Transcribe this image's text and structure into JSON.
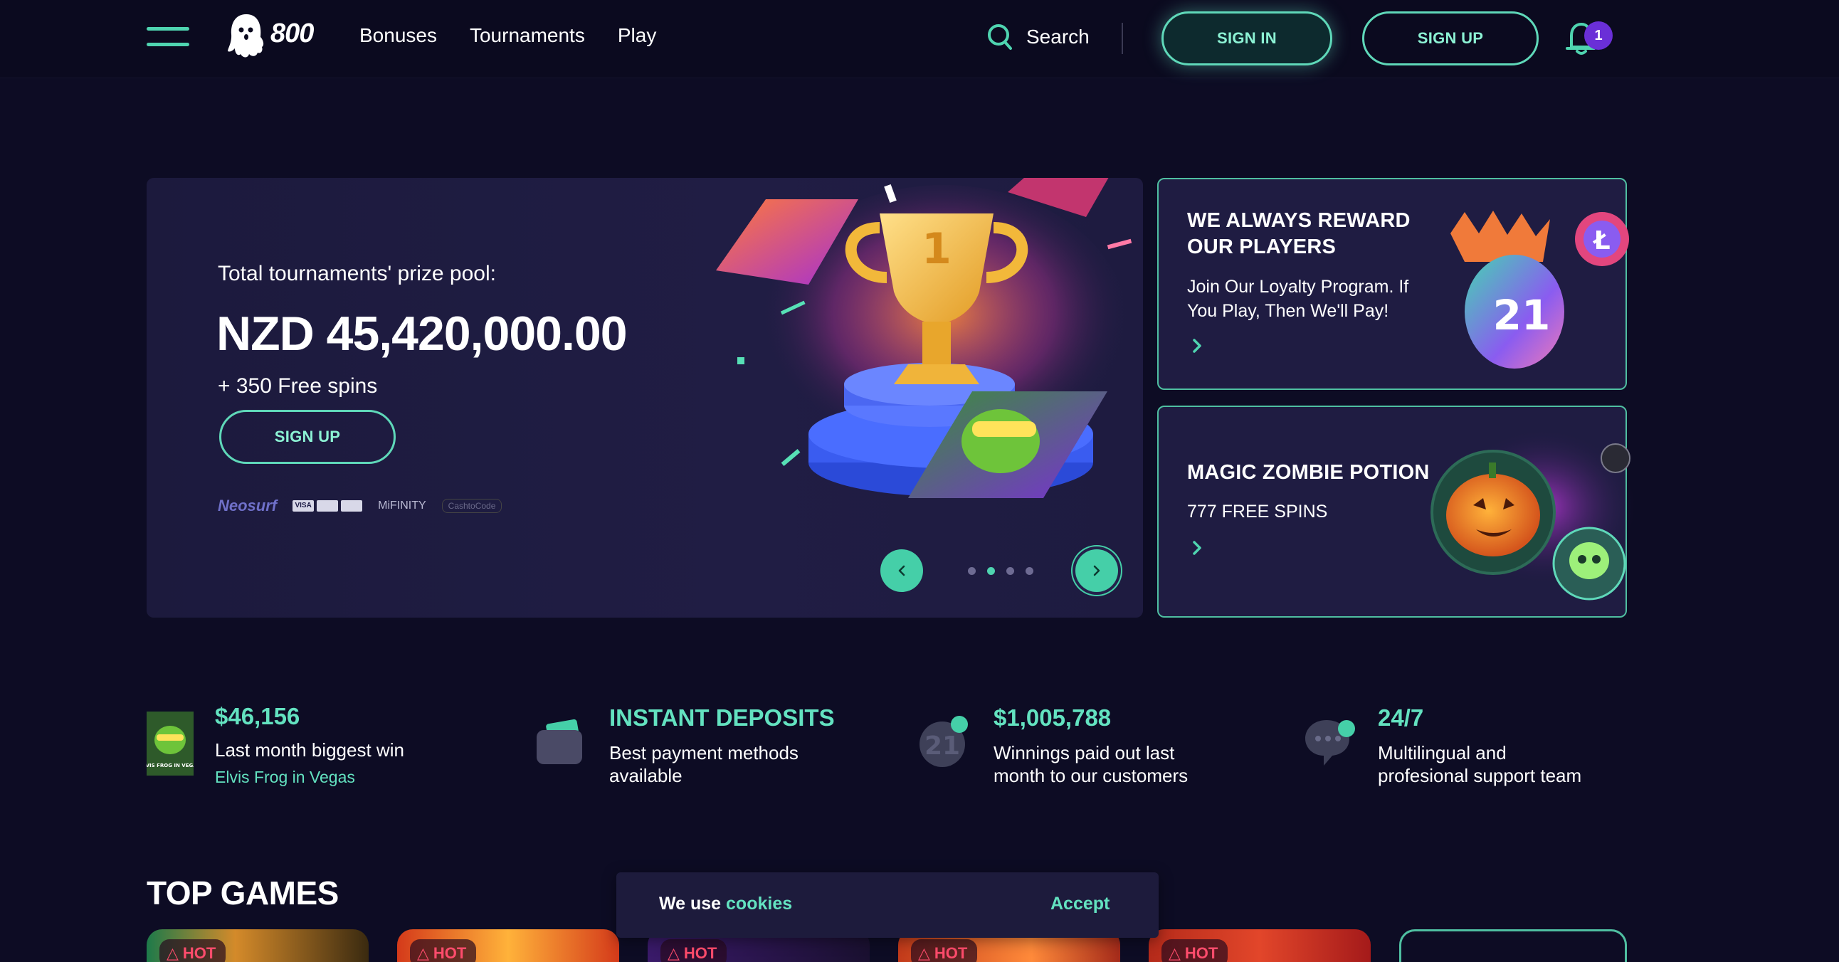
{
  "header": {
    "logo_text": "800",
    "nav": [
      "Bonuses",
      "Tournaments",
      "Play"
    ],
    "search_label": "Search",
    "signin_label": "SIGN IN",
    "signup_label": "SIGN UP",
    "notification_count": "1"
  },
  "hero": {
    "label": "Total tournaments' prize pool:",
    "amount": "NZD 45,420,000.00",
    "spins": "+ 350 Free spins",
    "signup_label": "SIGN UP",
    "payments": {
      "neosurf": "Neosurf",
      "cards": [
        "VISA",
        "",
        ""
      ],
      "mifinity": "MiFINITY",
      "cashcode": "CashtoCode"
    },
    "slide_count": 4,
    "active_slide": 2,
    "icons": {
      "prev": "chevron-left-icon",
      "next": "chevron-right-icon"
    }
  },
  "promos": [
    {
      "title_line1": "WE ALWAYS REWARD",
      "title_line2": "OUR PLAYERS",
      "text_line1": "Join Our Loyalty Program. If",
      "text_line2": "You Play, Then We'll Pay!",
      "badge": "21"
    },
    {
      "title_line1": "MAGIC ZOMBIE POTION",
      "text_line1": "777 FREE SPINS"
    }
  ],
  "stats": [
    {
      "title": "$46,156",
      "line1": "Last month biggest win",
      "link": "Elvis Frog in Vegas",
      "thumb_text": "ELVIS FROG IN VEGAS"
    },
    {
      "title": "INSTANT DEPOSITS",
      "line1": "Best payment methods",
      "line2": "available"
    },
    {
      "title": "$1,005,788",
      "line1": "Winnings paid out last",
      "line2": "month to our customers"
    },
    {
      "title": "24/7",
      "line1": "Multilingual and",
      "line2": "profesional support team"
    }
  ],
  "top_games": {
    "title": "TOP GAMES",
    "badge": "HOT"
  },
  "cookie": {
    "text": "We use",
    "link": "cookies",
    "accept": "Accept"
  },
  "colors": {
    "background": "#0d0c24",
    "accent": "#4fd4b0",
    "accent_text": "#63e2c0",
    "card": "#1f1c42",
    "badge": "#6a2fd7",
    "hot": "#ff4c6c"
  }
}
